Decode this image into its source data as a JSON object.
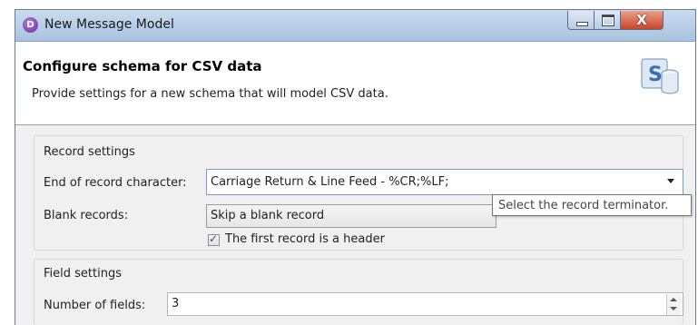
{
  "window": {
    "title": "New Message Model",
    "app_icon_glyph": "D"
  },
  "title_buttons": {
    "minimize": "minimize-icon",
    "maximize": "maximize-icon",
    "close": "X"
  },
  "banner": {
    "title": "Configure schema for CSV data",
    "description": "Provide settings for a new schema that will model CSV data.",
    "icon": "schema-database-icon",
    "icon_letter": "S"
  },
  "record_settings": {
    "group_label": "Record settings",
    "end_of_record_label": "End of record character:",
    "end_of_record_value": "Carriage Return & Line Feed - %CR;%LF;",
    "blank_records_label": "Blank records:",
    "blank_records_value": "Skip a blank record",
    "tooltip": "Select the record terminator.",
    "header_checkbox_label": "The first record is a header",
    "header_checkbox_checked": true
  },
  "field_settings": {
    "group_label": "Field settings",
    "num_fields_label": "Number of fields:",
    "num_fields_value": "3"
  },
  "colors": {
    "focus_border": "#7a9cc6",
    "title_bar": "#b9cfe8",
    "close_button": "#c9452a"
  }
}
